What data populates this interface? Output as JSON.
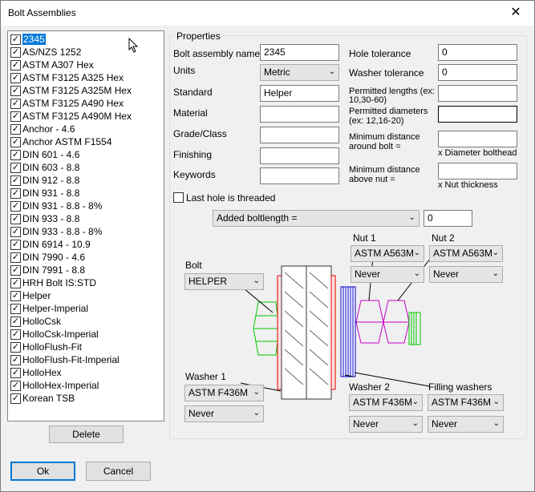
{
  "window": {
    "title": "Bolt Assemblies",
    "close_glyph": "✕"
  },
  "list": {
    "check_glyph": "✓",
    "items": [
      "2345",
      "AS/NZS 1252",
      "ASTM A307 Hex",
      "ASTM F3125 A325 Hex",
      "ASTM F3125 A325M Hex",
      "ASTM F3125 A490 Hex",
      "ASTM F3125 A490M Hex",
      "Anchor - 4.6",
      "Anchor ASTM F1554",
      "DIN 601 - 4.6",
      "DIN 603 - 8.8",
      "DIN 912 - 8.8",
      "DIN 931 - 8.8",
      "DIN 931 - 8.8 - 8%",
      "DIN 933 - 8.8",
      "DIN 933 - 8.8 - 8%",
      "DIN 6914 - 10.9",
      "DIN 7990 - 4.6",
      "DIN 7991 - 8.8",
      "HRH Bolt IS:STD",
      "Helper",
      "Helper-Imperial",
      "HolloCsk",
      "HolloCsk-Imperial",
      "HolloFlush-Fit",
      "HolloFlush-Fit-Imperial",
      "HolloHex",
      "HolloHex-Imperial",
      "Korean TSB"
    ],
    "selected": "2345"
  },
  "buttons": {
    "delete": "Delete",
    "ok": "Ok",
    "cancel": "Cancel"
  },
  "properties": {
    "group_label": "Properties",
    "bolt_assembly_name_label": "Bolt assembly name",
    "bolt_assembly_name_value": "2345",
    "units_label": "Units",
    "units_value": "Metric",
    "standard_label": "Standard",
    "standard_value": "Helper",
    "material_label": "Material",
    "grade_label": "Grade/Class",
    "finishing_label": "Finishing",
    "keywords_label": "Keywords",
    "hole_tolerance_label": "Hole tolerance",
    "hole_tolerance_value": "0",
    "washer_tolerance_label": "Washer tolerance",
    "washer_tolerance_value": "0",
    "permitted_lengths_label_1": "Permitted lengths (ex:",
    "permitted_lengths_label_2": "10,30-60)",
    "permitted_diameters_label_1": "Permitted diameters",
    "permitted_diameters_label_2": "(ex: 12,16-20)",
    "min_dist_bolt_label_1": "Minimum distance",
    "min_dist_bolt_label_2": "around bolt =",
    "min_dist_bolt_unit": "x Diameter bolthead",
    "min_dist_nut_label_1": "Minimum distance",
    "min_dist_nut_label_2": "above nut =",
    "min_dist_nut_unit": "x Nut thickness",
    "last_hole_threaded_label": "Last hole is threaded",
    "added_boltlength_label": "Added boltlength =",
    "added_boltlength_value": "0"
  },
  "assembly": {
    "bolt_label": "Bolt",
    "bolt_value": "HELPER",
    "nut1_label": "Nut 1",
    "nut1_value": "ASTM A563M",
    "nut1_option": "Never",
    "nut2_label": "Nut 2",
    "nut2_value": "ASTM A563M",
    "nut2_option": "Never",
    "washer1_label": "Washer 1",
    "washer1_value": "ASTM F436M",
    "washer1_option": "Never",
    "washer2_label": "Washer 2",
    "washer2_value": "ASTM F436M",
    "washer2_option": "Never",
    "filling_label": "Filling washers",
    "filling_value": "ASTM F436M",
    "filling_option": "Never"
  },
  "colors": {
    "selection": "#0078d7",
    "bolt_green": "#00c800",
    "washer_red": "#e00000",
    "filler_blue": "#0000c8",
    "nut_magenta": "#c800c8"
  }
}
